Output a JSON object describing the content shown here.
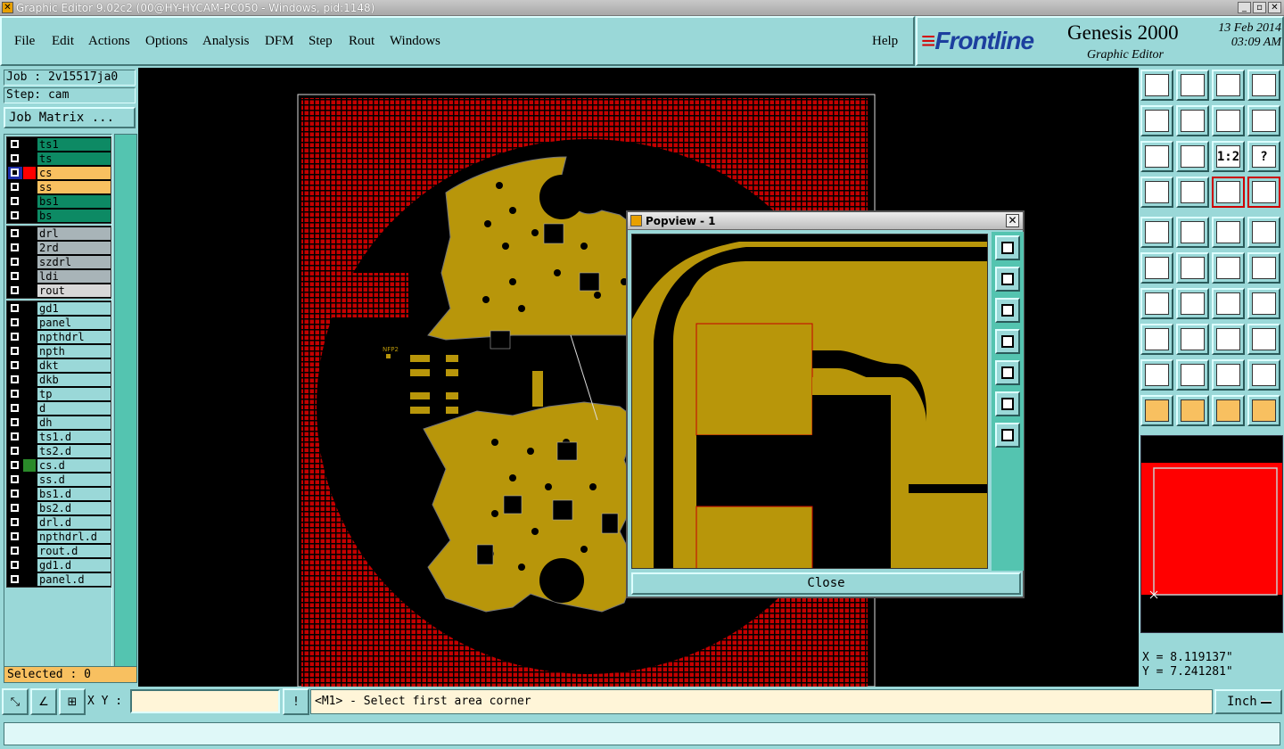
{
  "window": {
    "title": "Graphic Editor 9.02c2 (00@HY-HYCAM-PC050 - Windows, pid:1148)"
  },
  "menus": [
    "File",
    "Edit",
    "Actions",
    "Options",
    "Analysis",
    "DFM",
    "Step",
    "Rout",
    "Windows"
  ],
  "menu_help": "Help",
  "brand": {
    "logo": "Frontline",
    "product": "Genesis 2000",
    "subtitle": "Graphic Editor",
    "date": "13 Feb 2014",
    "time": "03:09 AM"
  },
  "job": {
    "job_line": "Job : 2v15517ja0",
    "step_line": "Step: cam",
    "matrix_button": "Job Matrix ..."
  },
  "layers": {
    "board": [
      "ts1",
      "ts",
      "cs",
      "ss",
      "bs1",
      "bs"
    ],
    "drill": [
      "drl",
      "2rd",
      "szdrl",
      "ldi",
      "rout"
    ],
    "misc": [
      "gd1",
      "panel",
      "npthdrl",
      "npth",
      "dkt",
      "dkb",
      "tp",
      "d",
      "dh",
      "ts1.d",
      "ts2.d",
      "cs.d",
      "ss.d",
      "bs1.d",
      "bs2.d",
      "drl.d",
      "npthdrl.d",
      "rout.d",
      "gd1.d",
      "panel.d"
    ],
    "active": "cs",
    "colors": {
      "board": "#0d8a64",
      "drill": "#a8b4b8",
      "highlight": "#f8c060",
      "copper": "#b8960a",
      "mask": "#c00000"
    }
  },
  "selected_label": "Selected : 0",
  "canvas": {
    "part_label": "NFP2"
  },
  "popview": {
    "title": "Popview - 1",
    "close_label": "Close"
  },
  "coords": {
    "x_line": "X = 8.119137\"",
    "y_line": "Y = 7.241281\""
  },
  "bottom": {
    "xy_label": "X Y :",
    "xy_value": "",
    "status": "<M1> - Select first area corner",
    "unit": "Inch"
  },
  "tools": [
    "zoom-home",
    "zoom-back",
    "zoom-home-alt",
    "view-panel",
    "pan-left",
    "pan-right",
    "undo-view",
    "redo-view",
    "fit-all",
    "fit-profile",
    "ratio-1-2",
    "help",
    "measure",
    "grid",
    "snap-red",
    "snap-red-2",
    "add-pad",
    "line-add",
    "ruler",
    "circle",
    "connect",
    "delete",
    "line-red",
    "line-blue",
    "angle-line",
    "line-diag",
    "arc",
    "text-f",
    "place-dots",
    "line-split",
    "dimension",
    "arrange",
    "triangle-1",
    "triangle-2",
    "triangle-3",
    "triangle-4",
    "select-pointer",
    "select-box",
    "select-area",
    "select-net"
  ],
  "tool_text": {
    "ratio-1-2": "1:2",
    "help": "?"
  }
}
